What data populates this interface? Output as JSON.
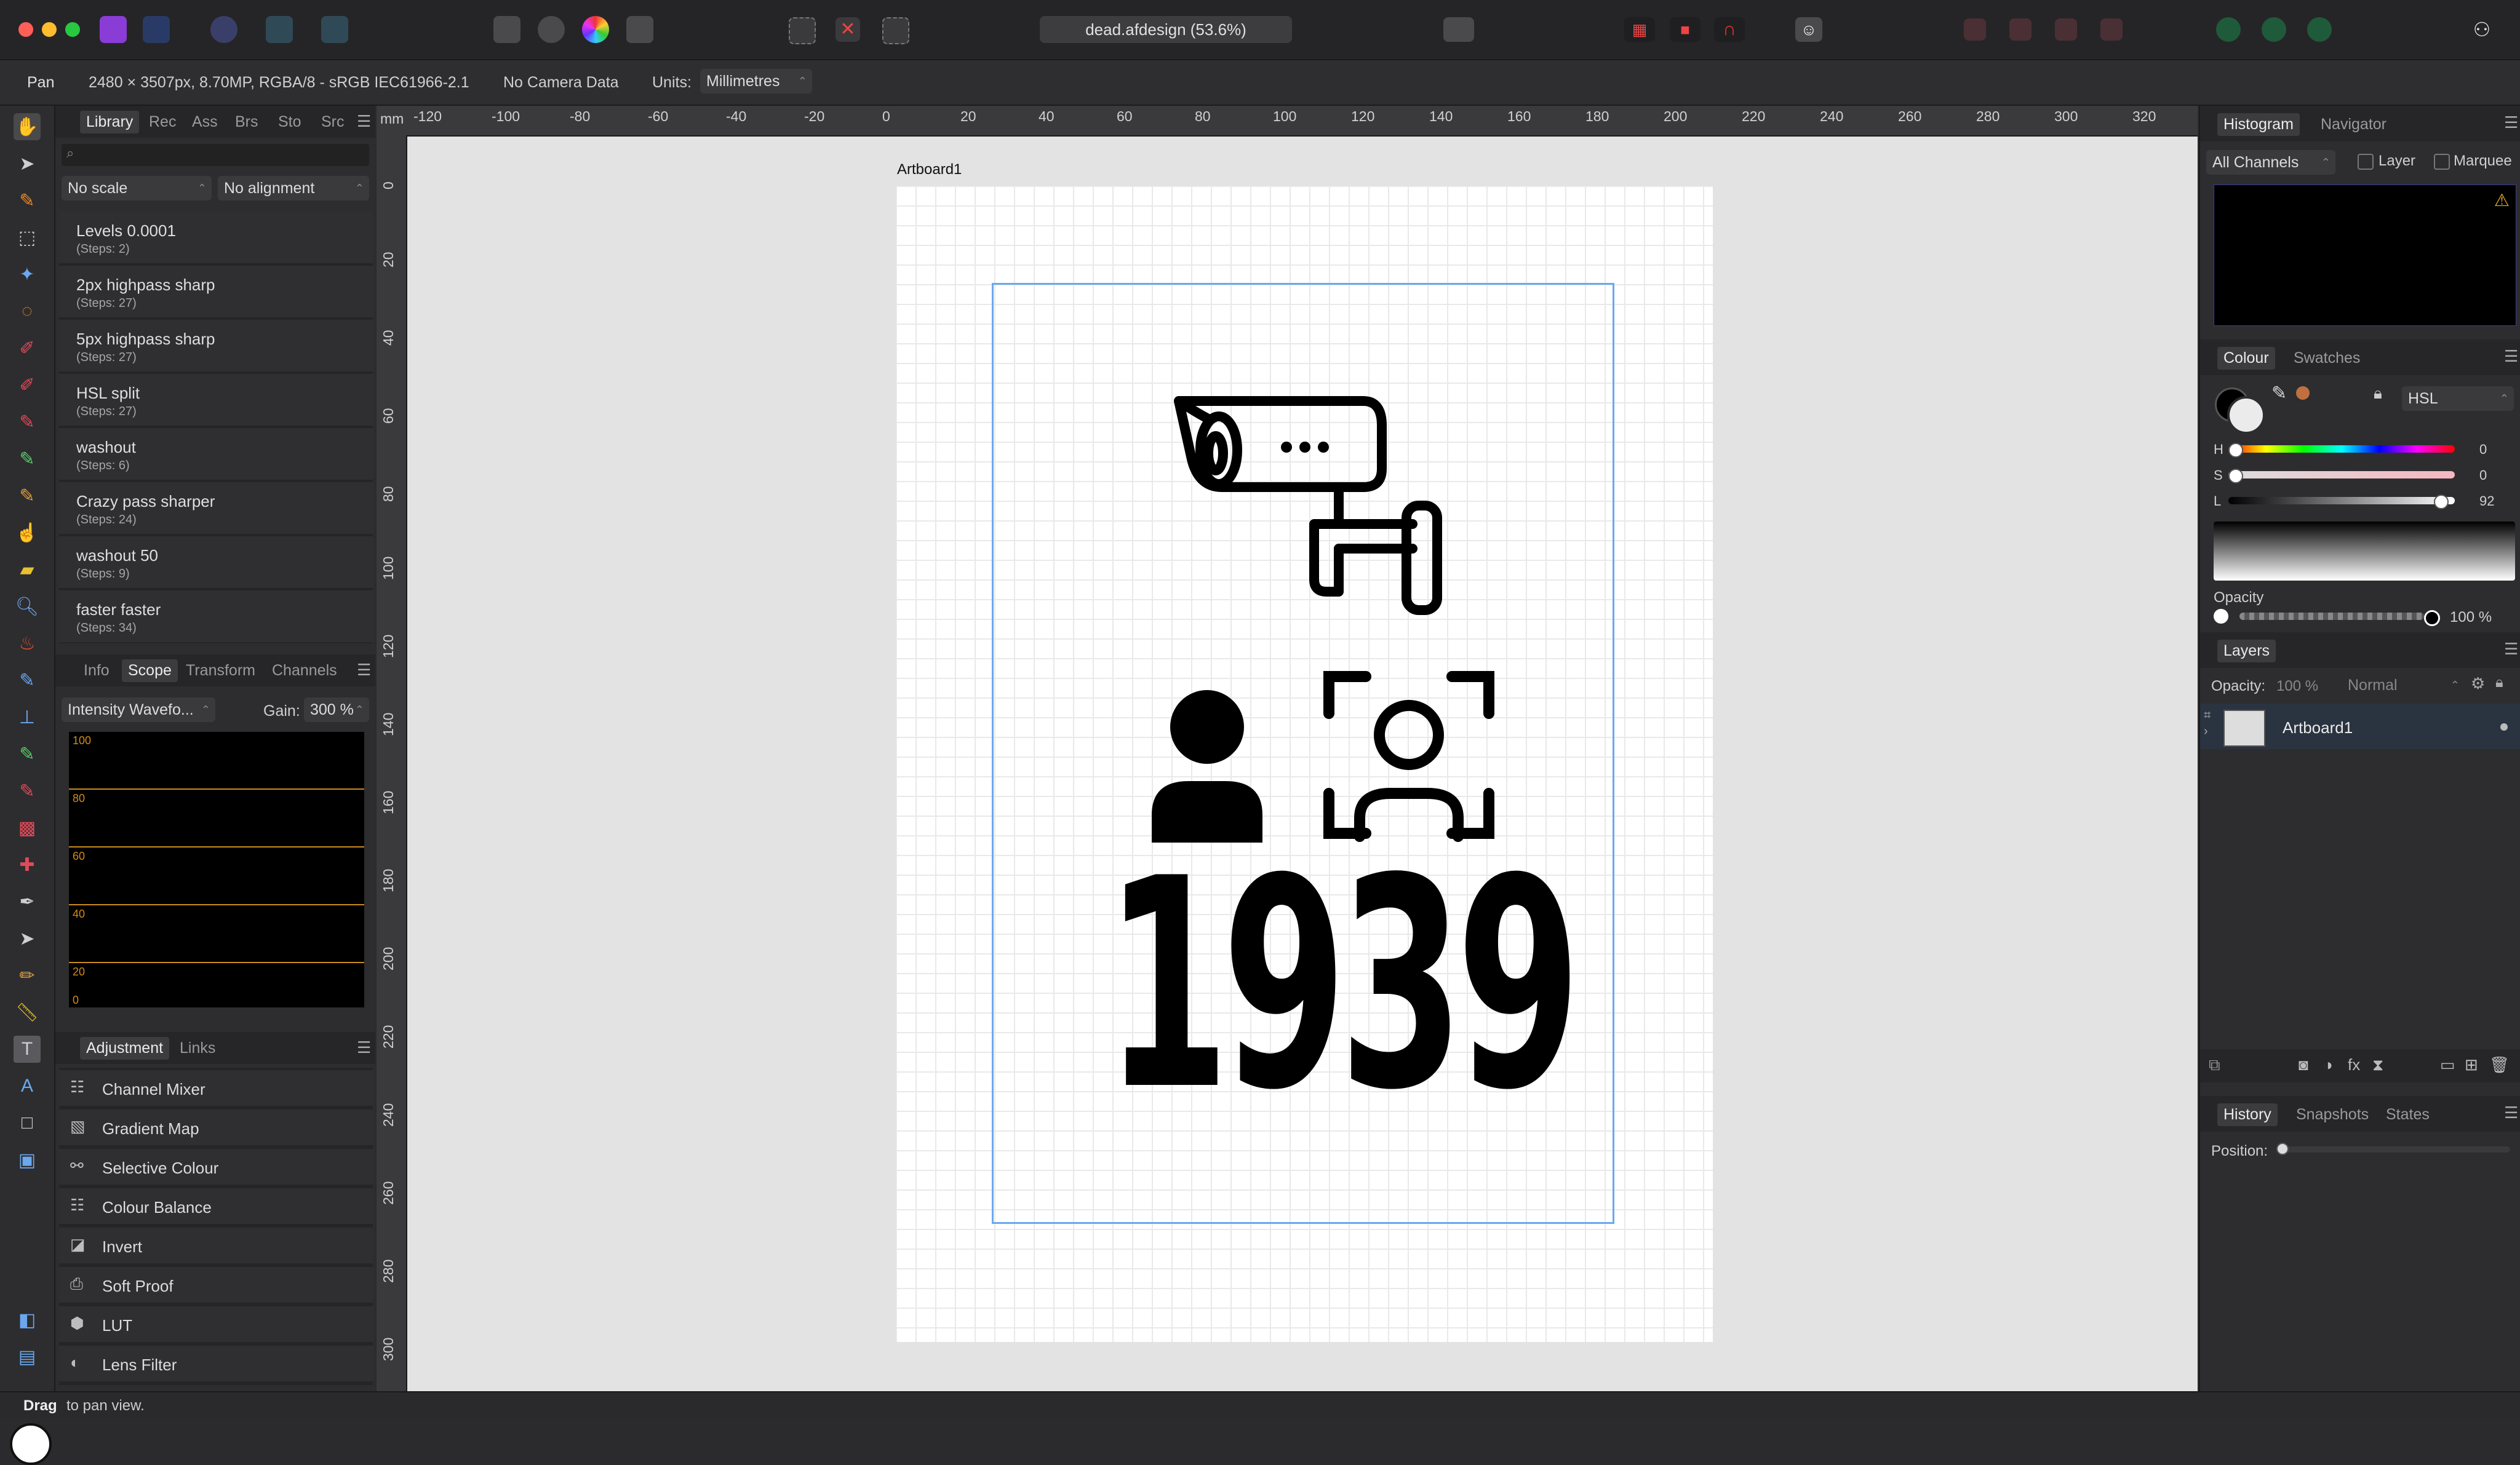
{
  "title_bar": {
    "document_title": "dead.afdesign (53.6%)"
  },
  "context_bar": {
    "tool_name": "Pan",
    "doc_info": "2480 × 3507px, 8.70MP, RGBA/8 - sRGB IEC61966-2.1",
    "camera": "No Camera Data",
    "units_label": "Units:",
    "units_value": "Millimetres"
  },
  "left_panel": {
    "tabs": [
      "Library",
      "Rec",
      "Ass",
      "Brs",
      "Sto",
      "Src"
    ],
    "scale_select": "No scale",
    "align_select": "No alignment",
    "library_items": [
      {
        "title": "Levels 0.0001",
        "steps": "(Steps: 2)"
      },
      {
        "title": "2px highpass sharp",
        "steps": "(Steps: 27)"
      },
      {
        "title": "5px highpass sharp",
        "steps": "(Steps: 27)"
      },
      {
        "title": "HSL split",
        "steps": "(Steps: 27)"
      },
      {
        "title": "washout",
        "steps": "(Steps: 6)"
      },
      {
        "title": "Crazy pass sharper",
        "steps": "(Steps: 24)"
      },
      {
        "title": "washout 50",
        "steps": "(Steps: 9)"
      },
      {
        "title": "faster faster",
        "steps": "(Steps: 34)"
      }
    ],
    "scope_tabs": [
      "Info",
      "Scope",
      "Transform",
      "Channels"
    ],
    "scope_mode": "Intensity Wavefo...",
    "gain_label": "Gain:",
    "gain_value": "300 %",
    "scope_levels": [
      "100",
      "80",
      "60",
      "40",
      "20",
      "0"
    ],
    "adjust_tabs": [
      "Adjustment",
      "Links"
    ],
    "adjustments": [
      "Channel Mixer",
      "Gradient Map",
      "Selective Colour",
      "Colour Balance",
      "Invert",
      "Soft Proof",
      "LUT",
      "Lens Filter"
    ]
  },
  "rulers": {
    "unit": "mm",
    "top_ticks": [
      "-120",
      "-100",
      "-80",
      "-60",
      "-40",
      "-20",
      "0",
      "20",
      "40",
      "60",
      "80",
      "100",
      "120",
      "140",
      "160",
      "180",
      "200",
      "220",
      "240",
      "260",
      "280",
      "300",
      "320"
    ],
    "left_ticks": [
      "0",
      "20",
      "40",
      "60",
      "80",
      "100",
      "120",
      "140",
      "160",
      "180",
      "200",
      "220",
      "240",
      "260",
      "280",
      "300"
    ]
  },
  "canvas": {
    "artboard_label": "Artboard1",
    "year_text": "1939",
    "icons": [
      "security-camera-icon",
      "person-icon",
      "face-scan-icon"
    ]
  },
  "right_panel": {
    "histogram_tabs": [
      "Histogram",
      "Navigator"
    ],
    "channels_select": "All Channels",
    "layer_check": "Layer",
    "marquee_check": "Marquee",
    "colour_tabs": [
      "Colour",
      "Swatches"
    ],
    "colour_model": "HSL",
    "h_label": "H",
    "h_value": "0",
    "s_label": "S",
    "s_value": "0",
    "l_label": "L",
    "l_value": "92",
    "opacity_label": "Opacity",
    "opacity_value": "100 %",
    "layers_title": "Layers",
    "layers_opacity_label": "Opacity:",
    "layers_opacity_value": "100 %",
    "blend_mode": "Normal",
    "layer_name": "Artboard1",
    "history_tabs": [
      "History",
      "Snapshots",
      "States"
    ],
    "position_label": "Position:"
  },
  "status_bar": {
    "bold": "Drag",
    "rest": "to pan view."
  },
  "colors": {
    "accent": "#4a8fe0",
    "scope_line": "#c98a1e",
    "traffic_red": "#ff5f57",
    "traffic_yellow": "#febc2e",
    "traffic_green": "#28c840"
  }
}
